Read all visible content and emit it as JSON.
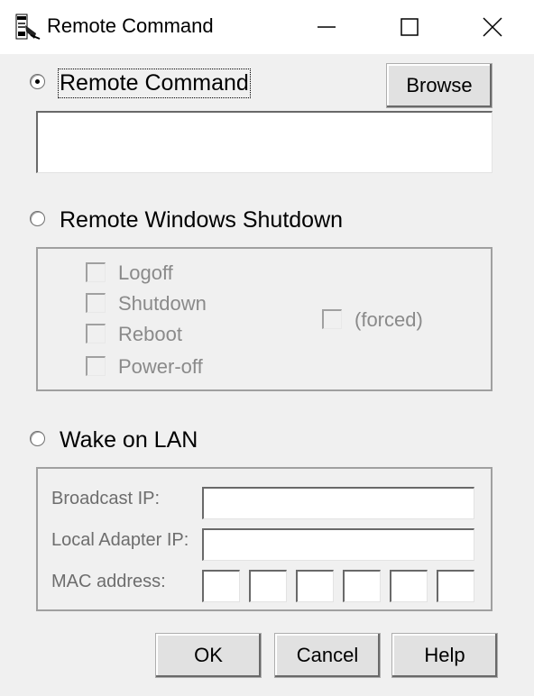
{
  "window": {
    "title": "Remote Command",
    "minimize_icon": "minimize-icon",
    "maximize_icon": "maximize-icon",
    "close_icon": "close-icon"
  },
  "remote_command": {
    "label": "Remote Command",
    "browse_label": "Browse",
    "command_value": "",
    "selected": true
  },
  "shutdown": {
    "label": "Remote Windows Shutdown",
    "options": [
      "Logoff",
      "Shutdown",
      "Reboot",
      "Power-off"
    ],
    "forced_label": "(forced)"
  },
  "wol": {
    "label": "Wake on LAN",
    "broadcast_label": "Broadcast IP:",
    "broadcast_value": "",
    "local_adapter_label": "Local Adapter IP:",
    "local_adapter_value": "",
    "mac_label": "MAC address:",
    "mac_values": [
      "",
      "",
      "",
      "",
      "",
      ""
    ]
  },
  "buttons": {
    "ok": "OK",
    "cancel": "Cancel",
    "help": "Help"
  }
}
